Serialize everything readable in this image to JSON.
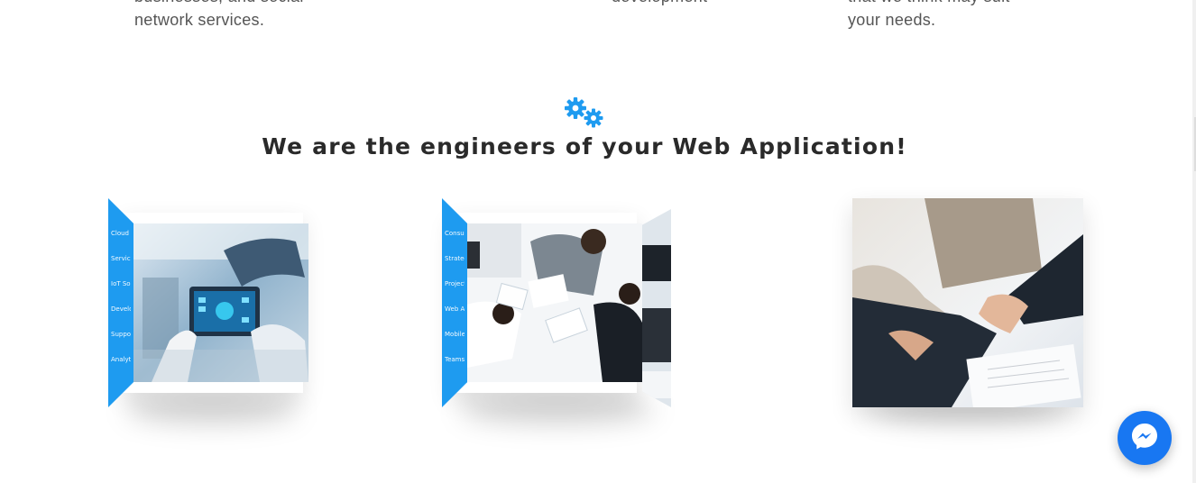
{
  "features": {
    "col1_line1": "businesses, and social",
    "col1_line2": "network services.",
    "col2_line1": "development",
    "col3_line1": "that we think may suit",
    "col3_line2": "your needs."
  },
  "section": {
    "icon": "gears-icon",
    "title": "We are the engineers of your Web Application!"
  },
  "cards": [
    {
      "name": "industry-automation",
      "panel_lines": [
        "Cloud",
        "Services",
        "IoT Solutions",
        "Development",
        "Support",
        "Analytics"
      ]
    },
    {
      "name": "business-meeting",
      "panel_lines": [
        "Consulting",
        "Strategy",
        "Project Planning",
        "Web Apps",
        "Mobile",
        "Teams"
      ]
    },
    {
      "name": "handshake",
      "panel_lines": []
    }
  ],
  "colors": {
    "accent": "#1e9bf0",
    "title": "#2a2a2a",
    "messenger": "#1877f2"
  },
  "messenger": {
    "icon": "messenger-icon"
  }
}
